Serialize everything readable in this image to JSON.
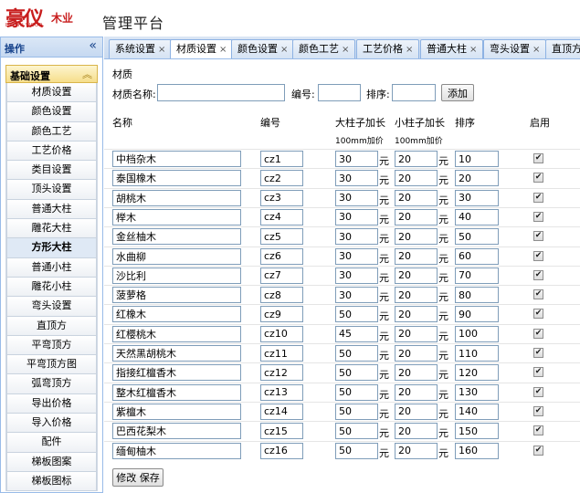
{
  "header": {
    "logo_mark": "豪仪",
    "logo_text": "木业",
    "logo_sub": "HAISHI WOOD",
    "title": "管理平台"
  },
  "sidebar": {
    "title": "操作",
    "collapse_glyph": "«",
    "group_title": "基础设置",
    "group_glyph": "︽",
    "items": [
      {
        "label": "材质设置"
      },
      {
        "label": "颜色设置"
      },
      {
        "label": "颜色工艺"
      },
      {
        "label": "工艺价格"
      },
      {
        "label": "类目设置"
      },
      {
        "label": "顶头设置"
      },
      {
        "label": "普通大柱"
      },
      {
        "label": "雕花大柱"
      },
      {
        "label": "方形大柱"
      },
      {
        "label": "普通小柱"
      },
      {
        "label": "雕花小柱"
      },
      {
        "label": "弯头设置"
      },
      {
        "label": "直顶方"
      },
      {
        "label": "平弯顶方"
      },
      {
        "label": "平弯顶方图"
      },
      {
        "label": "弧弯顶方"
      },
      {
        "label": "导出价格"
      },
      {
        "label": "导入价格"
      },
      {
        "label": "配件"
      },
      {
        "label": "梯板图案"
      },
      {
        "label": "梯板图标"
      }
    ],
    "active_index": 8
  },
  "tabs": [
    {
      "label": "系统设置"
    },
    {
      "label": "材质设置"
    },
    {
      "label": "颜色设置"
    },
    {
      "label": "颜色工艺"
    },
    {
      "label": "工艺价格"
    },
    {
      "label": "普通大柱"
    },
    {
      "label": "弯头设置"
    },
    {
      "label": "直顶方"
    }
  ],
  "active_tab": 1,
  "close_glyph": "×",
  "form": {
    "section_title": "材质",
    "name_label": "材质名称:",
    "name_value": "",
    "code_label": "编号:",
    "code_value": "",
    "order_label": "排序:",
    "order_value": "",
    "add_label": "添加"
  },
  "table": {
    "columns": {
      "name": "名称",
      "code": "编号",
      "big": "大柱子加长",
      "big_sub": "100mm加价",
      "small": "小柱子加长",
      "small_sub": "100mm加价",
      "order": "排序",
      "enabled": "启用"
    },
    "unit": "元",
    "check_glyph": "✔",
    "rows": [
      {
        "name": "中档杂木",
        "code": "cz1",
        "big": "30",
        "small": "20",
        "order": "10",
        "enabled": true
      },
      {
        "name": "泰国橡木",
        "code": "cz2",
        "big": "30",
        "small": "20",
        "order": "20",
        "enabled": true
      },
      {
        "name": "胡桃木",
        "code": "cz3",
        "big": "30",
        "small": "20",
        "order": "30",
        "enabled": true
      },
      {
        "name": "榉木",
        "code": "cz4",
        "big": "30",
        "small": "20",
        "order": "40",
        "enabled": true
      },
      {
        "name": "金丝柚木",
        "code": "cz5",
        "big": "30",
        "small": "20",
        "order": "50",
        "enabled": true
      },
      {
        "name": "水曲柳",
        "code": "cz6",
        "big": "30",
        "small": "20",
        "order": "60",
        "enabled": true
      },
      {
        "name": "沙比利",
        "code": "cz7",
        "big": "30",
        "small": "20",
        "order": "70",
        "enabled": true
      },
      {
        "name": "菠萝格",
        "code": "cz8",
        "big": "30",
        "small": "20",
        "order": "80",
        "enabled": true
      },
      {
        "name": "红橡木",
        "code": "cz9",
        "big": "50",
        "small": "20",
        "order": "90",
        "enabled": true
      },
      {
        "name": "红樱桃木",
        "code": "cz10",
        "big": "45",
        "small": "20",
        "order": "100",
        "enabled": true
      },
      {
        "name": "天然黑胡桃木",
        "code": "cz11",
        "big": "50",
        "small": "20",
        "order": "110",
        "enabled": true
      },
      {
        "name": "指接红檀香木",
        "code": "cz12",
        "big": "50",
        "small": "20",
        "order": "120",
        "enabled": true
      },
      {
        "name": "整木红檀香木",
        "code": "cz13",
        "big": "50",
        "small": "20",
        "order": "130",
        "enabled": true
      },
      {
        "name": "紫檀木",
        "code": "cz14",
        "big": "50",
        "small": "20",
        "order": "140",
        "enabled": true
      },
      {
        "name": "巴西花梨木",
        "code": "cz15",
        "big": "50",
        "small": "20",
        "order": "150",
        "enabled": true
      },
      {
        "name": "缅甸柚木",
        "code": "cz16",
        "big": "50",
        "small": "20",
        "order": "160",
        "enabled": true
      }
    ]
  },
  "save_label": "修改 保存"
}
